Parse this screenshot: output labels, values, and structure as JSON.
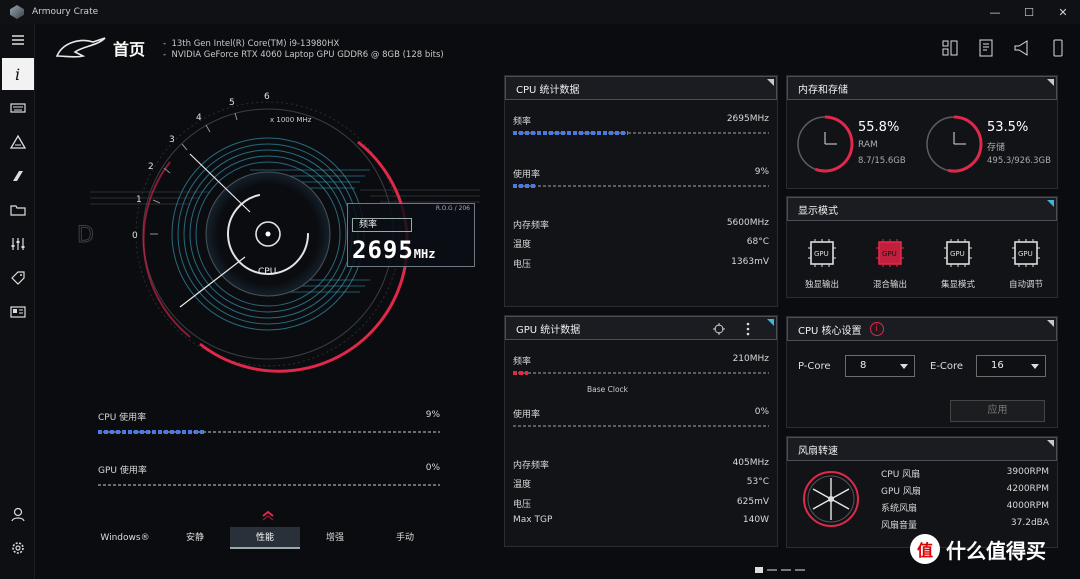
{
  "app": {
    "title": "Armoury Crate"
  },
  "window": {
    "minimize": "—",
    "maximize": "☐",
    "close": "✕"
  },
  "header": {
    "page_title": "首页",
    "cpu_spec": "13th Gen Intel(R) Core(TM) i9-13980HX",
    "gpu_spec": "NVIDIA GeForce RTX 4060 Laptop GPU GDDR6 @ 8GB (128 bits)"
  },
  "gauge": {
    "scale_labels": [
      "0",
      "1",
      "2",
      "3",
      "4",
      "5",
      "6"
    ],
    "scale_unit": "x 1000 MHz",
    "center_label": "CPU",
    "rog_tag": "R.O.G / 206",
    "freq_label": "频率",
    "freq_value": "2695",
    "freq_unit": "MHz",
    "left_letter": "D"
  },
  "usage": {
    "cpu": {
      "label": "CPU 使用率",
      "value": "9%",
      "fraction": 0.09
    },
    "gpu": {
      "label": "GPU 使用率",
      "value": "0%",
      "fraction": 0.0
    }
  },
  "modes": {
    "items": [
      "Windows®",
      "安静",
      "性能",
      "增强",
      "手动"
    ],
    "active": "性能"
  },
  "cpu_stats": {
    "title": "CPU 统计数据",
    "freq_label": "频率",
    "freq_value": "2695MHz",
    "freq_fraction": 0.45,
    "usage_label": "使用率",
    "usage_value": "9%",
    "usage_fraction": 0.09,
    "mem_freq_label": "内存频率",
    "mem_freq_value": "5600MHz",
    "temp_label": "温度",
    "temp_value": "68°C",
    "volt_label": "电压",
    "volt_value": "1363mV"
  },
  "gpu_stats": {
    "title": "GPU 统计数据",
    "freq_label": "频率",
    "freq_value": "210MHz",
    "freq_fraction": 0.06,
    "base_clock_label": "Base Clock",
    "usage_label": "使用率",
    "usage_value": "0%",
    "mem_freq_label": "内存频率",
    "mem_freq_value": "405MHz",
    "temp_label": "温度",
    "temp_value": "53°C",
    "volt_label": "电压",
    "volt_value": "625mV",
    "tgp_label": "Max TGP",
    "tgp_value": "140W"
  },
  "memory": {
    "title": "内存和存储",
    "ram": {
      "pct": "55.8%",
      "label": "RAM",
      "value": "8.7/15.6GB",
      "fraction": 0.558
    },
    "storage": {
      "pct": "53.5%",
      "label": "存储",
      "value": "495.3/926.3GB",
      "fraction": 0.535
    }
  },
  "display": {
    "title": "显示模式",
    "items": [
      "独显输出",
      "混合输出",
      "集显模式",
      "自动调节"
    ],
    "icon_text": "GPU",
    "active": "混合输出"
  },
  "cpu_core": {
    "title": "CPU 核心设置",
    "info": "i",
    "pcore_label": "P-Core",
    "pcore_value": "8",
    "ecore_label": "E-Core",
    "ecore_value": "16",
    "apply": "应用"
  },
  "fan": {
    "title": "风扇转速",
    "rows": [
      {
        "label": "CPU 风扇",
        "value": "3900RPM"
      },
      {
        "label": "GPU 风扇",
        "value": "4200RPM"
      },
      {
        "label": "系统风扇",
        "value": "4000RPM"
      },
      {
        "label": "风扇音量",
        "value": "37.2dBA"
      }
    ]
  },
  "brand": {
    "logo": "值",
    "text": "什么值得买"
  },
  "colors": {
    "accent_red": "#e0284a",
    "accent_blue": "#4a7ae0",
    "cyan": "#3fb6d8"
  }
}
